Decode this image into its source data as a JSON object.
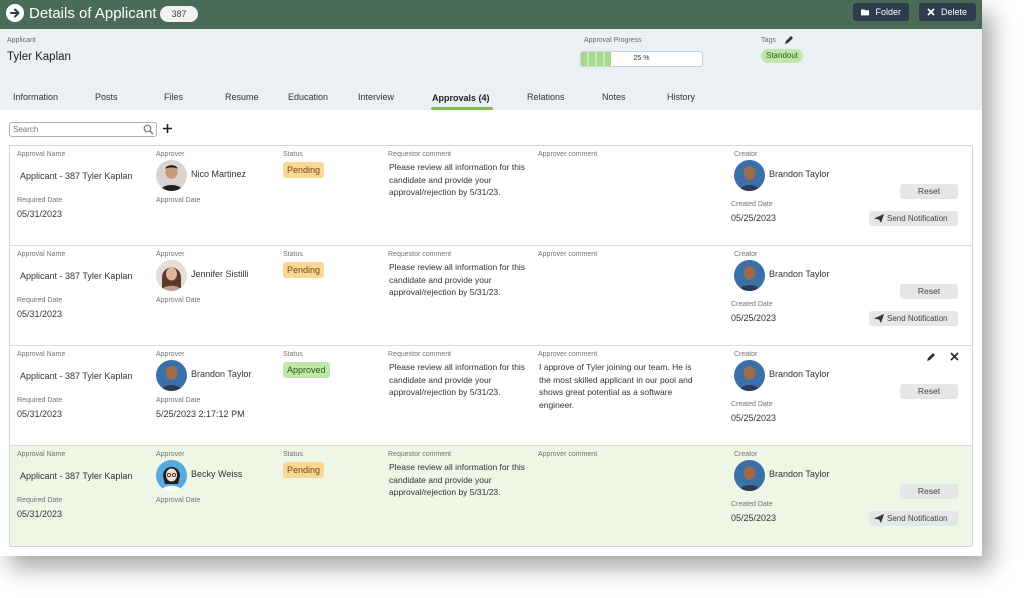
{
  "header": {
    "title": "Details of Applicant",
    "id_badge": "387",
    "folder_label": "Folder",
    "delete_label": "Delete"
  },
  "applicant": {
    "label": "Applicant",
    "name": "Tyler Kaplan"
  },
  "progress": {
    "label": "Approval Progress",
    "value_text": "25 %",
    "value": 0.25
  },
  "tags": {
    "label": "Tags",
    "items": [
      "Standout"
    ]
  },
  "tabs": [
    {
      "label": "Information"
    },
    {
      "label": "Posts"
    },
    {
      "label": "Files"
    },
    {
      "label": "Resume"
    },
    {
      "label": "Education"
    },
    {
      "label": "Interview"
    },
    {
      "label": "Approvals (4)"
    },
    {
      "label": "Relations"
    },
    {
      "label": "Notes"
    },
    {
      "label": "History"
    }
  ],
  "active_tab": "Approvals (4)",
  "search": {
    "placeholder": "Search"
  },
  "labels": {
    "approval_name": "Approval Name",
    "required_date": "Required Date",
    "approver": "Approver",
    "approval_date": "Approval Date",
    "status": "Status",
    "requestor_comment": "Requestor comment",
    "approver_comment": "Approver comment",
    "creator": "Creator",
    "created_date": "Created Date",
    "reset": "Reset",
    "send_notification": "Send Notification"
  },
  "approvals": [
    {
      "approval_name": "Applicant - 387 Tyler Kaplan",
      "required_date": "05/31/2023",
      "approver": "Nico Martinez",
      "approval_date": "",
      "status": "Pending",
      "requestor_comment": "Please review all information for this candidate and provide your approval/rejection by 5/31/23.",
      "approver_comment": "",
      "creator": "Brandon Taylor",
      "created_date": "05/25/2023"
    },
    {
      "approval_name": "Applicant - 387 Tyler Kaplan",
      "required_date": "05/31/2023",
      "approver": "Jennifer Sistilli",
      "approval_date": "",
      "status": "Pending",
      "requestor_comment": "Please review all information for this candidate and provide your approval/rejection by 5/31/23.",
      "approver_comment": "",
      "creator": "Brandon Taylor",
      "created_date": "05/25/2023"
    },
    {
      "approval_name": "Applicant - 387 Tyler Kaplan",
      "required_date": "05/31/2023",
      "approver": "Brandon Taylor",
      "approval_date": "5/25/2023 2:17:12 PM",
      "status": "Approved",
      "requestor_comment": "Please review all information for this candidate and provide your approval/rejection by 5/31/23.",
      "approver_comment": "I approve of Tyler joining our team. He is the most skilled applicant in our pool and shows great potential as a software engineer.",
      "creator": "Brandon Taylor",
      "created_date": "05/25/2023"
    },
    {
      "approval_name": "Applicant - 387 Tyler Kaplan",
      "required_date": "05/31/2023",
      "approver": "Becky Weiss",
      "approval_date": "",
      "status": "Pending",
      "requestor_comment": "Please review all information for this candidate and provide your approval/rejection by 5/31/23.",
      "approver_comment": "",
      "creator": "Brandon Taylor",
      "created_date": "05/25/2023"
    }
  ],
  "colors": {
    "topbar": "#4a6b57",
    "header_bg": "#eaf0f4",
    "accent_green": "#7cc04f",
    "pending": "#fbd795",
    "approved": "#bfe8a6",
    "highlight_row": "#eef6e6"
  }
}
